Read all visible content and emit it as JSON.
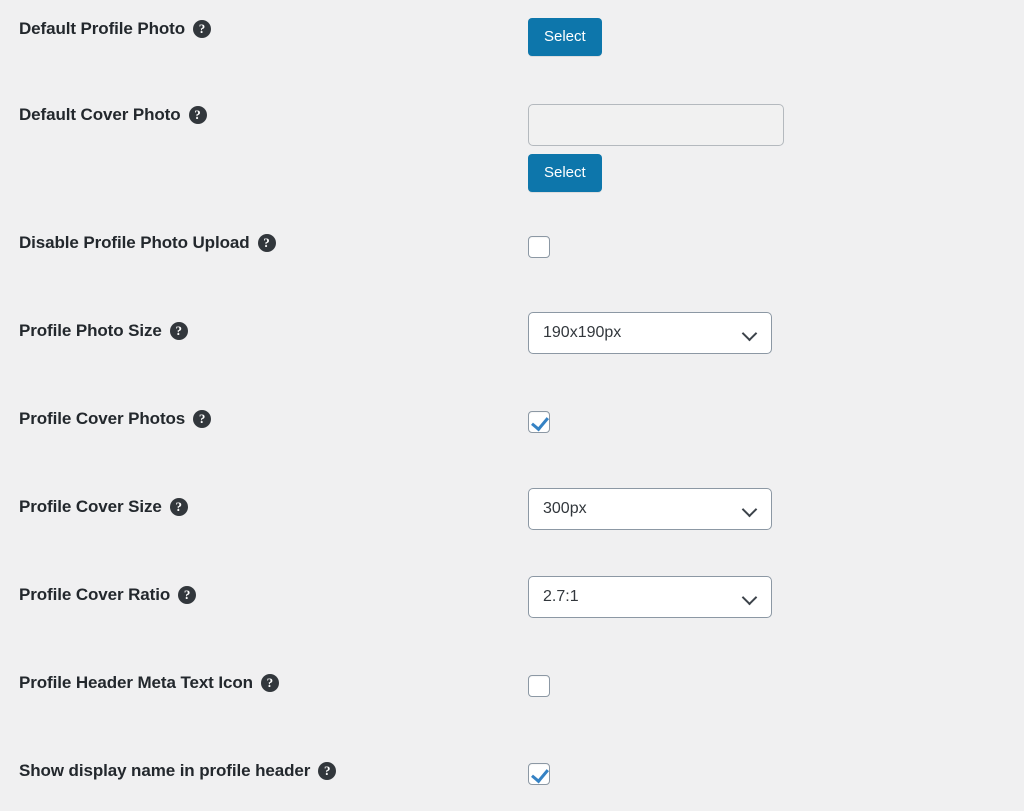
{
  "colors": {
    "page_background": "#f0f0f1",
    "button_blue": "#0d76ab",
    "check_blue": "#3582c4",
    "label_text": "#23282d",
    "help_icon_background": "#32373c"
  },
  "icons": {
    "help": "help-circle-icon",
    "chevron": "chevron-down-icon"
  },
  "settings": [
    {
      "id": "default-profile-photo",
      "label": "Default Profile Photo",
      "help": "?",
      "control": "button",
      "button_label": "Select"
    },
    {
      "id": "default-cover-photo",
      "label": "Default Cover Photo",
      "help": "?",
      "control": "input-with-button",
      "input_value": "",
      "input_placeholder": "",
      "button_label": "Select"
    },
    {
      "id": "disable-profile-photo-upload",
      "label": "Disable Profile Photo Upload",
      "help": "?",
      "control": "checkbox",
      "checked": false
    },
    {
      "id": "profile-photo-size",
      "label": "Profile Photo Size",
      "help": "?",
      "control": "select",
      "value": "190x190px"
    },
    {
      "id": "profile-cover-photos",
      "label": "Profile Cover Photos",
      "help": "?",
      "control": "checkbox",
      "checked": true
    },
    {
      "id": "profile-cover-size",
      "label": "Profile Cover Size",
      "help": "?",
      "control": "select",
      "value": "300px"
    },
    {
      "id": "profile-cover-ratio",
      "label": "Profile Cover Ratio",
      "help": "?",
      "control": "select",
      "value": "2.7:1"
    },
    {
      "id": "profile-header-meta-text-icon",
      "label": "Profile Header Meta Text Icon",
      "help": "?",
      "control": "checkbox",
      "checked": false
    },
    {
      "id": "show-display-name-in-profile-header",
      "label": "Show display name in profile header",
      "help": "?",
      "control": "checkbox",
      "checked": true
    }
  ]
}
